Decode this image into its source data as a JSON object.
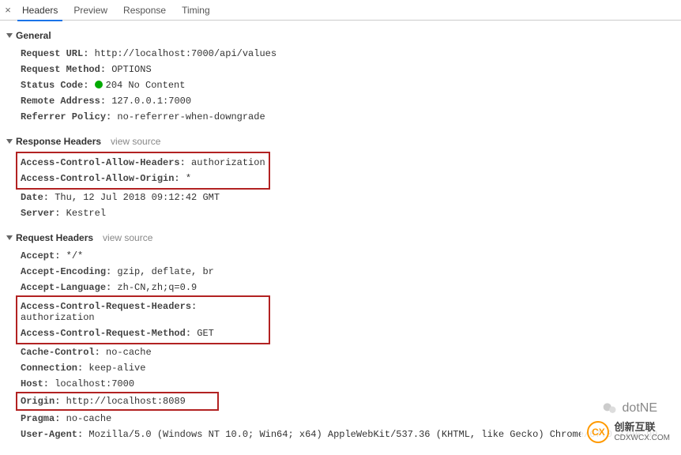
{
  "tabs": {
    "close": "×",
    "headers": "Headers",
    "preview": "Preview",
    "response": "Response",
    "timing": "Timing"
  },
  "general": {
    "title": "General",
    "request_url_label": "Request URL:",
    "request_url_value": "http://localhost:7000/api/values",
    "request_method_label": "Request Method:",
    "request_method_value": "OPTIONS",
    "status_code_label": "Status Code:",
    "status_code_value": "204 No Content",
    "remote_address_label": "Remote Address:",
    "remote_address_value": "127.0.0.1:7000",
    "referrer_policy_label": "Referrer Policy:",
    "referrer_policy_value": "no-referrer-when-downgrade"
  },
  "response_headers": {
    "title": "Response Headers",
    "view_source": "view source",
    "acah_label": "Access-Control-Allow-Headers:",
    "acah_value": "authorization",
    "acao_label": "Access-Control-Allow-Origin:",
    "acao_value": "*",
    "date_label": "Date:",
    "date_value": "Thu, 12 Jul 2018 09:12:42 GMT",
    "server_label": "Server:",
    "server_value": "Kestrel"
  },
  "request_headers": {
    "title": "Request Headers",
    "view_source": "view source",
    "accept_label": "Accept:",
    "accept_value": "*/*",
    "accept_encoding_label": "Accept-Encoding:",
    "accept_encoding_value": "gzip, deflate, br",
    "accept_language_label": "Accept-Language:",
    "accept_language_value": "zh-CN,zh;q=0.9",
    "acrh_label": "Access-Control-Request-Headers:",
    "acrh_value": "authorization",
    "acrm_label": "Access-Control-Request-Method:",
    "acrm_value": "GET",
    "cache_control_label": "Cache-Control:",
    "cache_control_value": "no-cache",
    "connection_label": "Connection:",
    "connection_value": "keep-alive",
    "host_label": "Host:",
    "host_value": "localhost:7000",
    "origin_label": "Origin:",
    "origin_value": "http://localhost:8089",
    "pragma_label": "Pragma:",
    "pragma_value": "no-cache",
    "user_agent_label": "User-Agent:",
    "user_agent_value": "Mozilla/5.0 (Windows NT 10.0; Win64; x64) AppleWebKit/537.36 (KHTML, like Gecko) Chrome/67.0.3396.99"
  },
  "wechat": {
    "text": "dotNE"
  },
  "watermark": {
    "cn": "创新互联",
    "en": "CDXWCX.COM"
  }
}
